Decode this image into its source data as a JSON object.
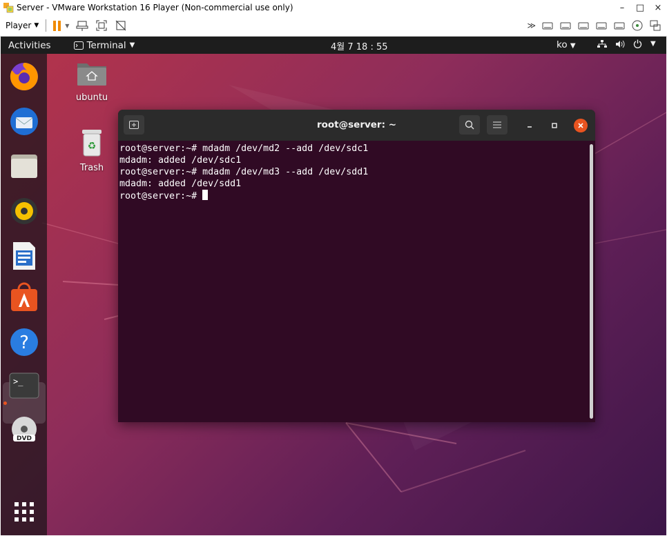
{
  "vmware": {
    "window_title": "Server - VMware Workstation 16 Player (Non-commercial use only)",
    "player_menu": "Player",
    "window_controls": [
      "–",
      "□",
      "×"
    ]
  },
  "gnome": {
    "activities": "Activities",
    "app_menu": "Terminal",
    "clock": "4월 7  18 : 55",
    "input_lang": "ko"
  },
  "desktop": {
    "icons": [
      {
        "label": "ubuntu",
        "icon": "home-folder-icon"
      },
      {
        "label": "Trash",
        "icon": "trash-icon"
      }
    ]
  },
  "dock": {
    "apps": [
      "firefox-icon",
      "thunderbird-icon",
      "files-icon",
      "rhythmbox-icon",
      "libreoffice-writer-icon",
      "software-center-icon",
      "help-icon",
      "terminal-icon",
      "dvd-icon",
      "show-apps-icon"
    ]
  },
  "terminal": {
    "title": "root@server: ~",
    "lines": [
      "root@server:~# mdadm /dev/md2 --add /dev/sdc1",
      "mdadm: added /dev/sdc1",
      "root@server:~# mdadm /dev/md3 --add /dev/sdd1",
      "mdadm: added /dev/sdd1"
    ],
    "prompt": "root@server:~# "
  },
  "colors": {
    "terminal_bg": "#300a24",
    "ubuntu_orange": "#e95420",
    "topbar_bg": "#1d1d1d"
  }
}
